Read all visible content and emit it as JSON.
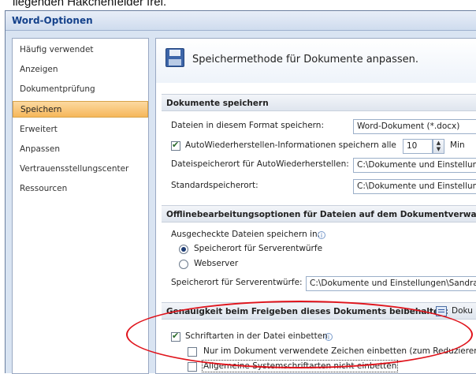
{
  "top_text": "liegenden Häkchenfelder frei.",
  "window": {
    "title": "Word-Optionen"
  },
  "sidebar": {
    "items": [
      {
        "label": "Häufig verwendet"
      },
      {
        "label": "Anzeigen"
      },
      {
        "label": "Dokumentprüfung"
      },
      {
        "label": "Speichern",
        "selected": true
      },
      {
        "label": "Erweitert"
      },
      {
        "label": "Anpassen"
      },
      {
        "label": "Vertrauensstellungscenter"
      },
      {
        "label": "Ressourcen"
      }
    ]
  },
  "header": {
    "title": "Speichermethode für Dokumente anpassen.",
    "icon": "floppy-disk-icon"
  },
  "sections": {
    "save": {
      "title": "Dokumente speichern",
      "format_label": "Dateien in diesem Format speichern:",
      "format_value": "Word-Dokument (*.docx)",
      "autorecover_label": "AutoWiederherstellen-Informationen speichern alle",
      "autorecover_checked": true,
      "autorecover_value": "10",
      "autorecover_unit": "Min",
      "autorecover_path_label": "Dateispeicherort für AutoWiederherstellen:",
      "autorecover_path_value": "C:\\Dokumente und Einstellun",
      "default_path_label": "Standardspeicherort:",
      "default_path_value": "C:\\Dokumente und Einstellun"
    },
    "offline": {
      "title": "Offlinebearbeitungsoptionen für Dateien auf dem Dokumentverwaltungsse",
      "checked_out_label": "Ausgecheckte Dateien speichern in:",
      "radio_server_drafts": "Speicherort für Serverentwürfe",
      "radio_server_drafts_checked": true,
      "radio_webserver": "Webserver",
      "radio_webserver_checked": false,
      "drafts_path_label": "Speicherort für Serverentwürfe:",
      "drafts_path_value": "C:\\Dokumente und Einstellungen\\Sandra"
    },
    "fidelity": {
      "title": "Genauigkeit beim Freigeben dieses Dokuments beibehalten:",
      "doc_value": "Doku",
      "embed_fonts_label": "Schriftarten in der Datei einbetten",
      "embed_fonts_checked": true,
      "only_used_chars_label": "Nur im Dokument verwendete Zeichen einbetten (zum Reduzieren d",
      "only_used_chars_checked": false,
      "no_system_fonts_label": "Allgemeine Systemschriftarten nicht einbetten",
      "no_system_fonts_checked": false
    }
  },
  "colors": {
    "selection": "#f6b75a",
    "highlight_ellipse": "#e0131b",
    "title_text": "#15428b"
  }
}
